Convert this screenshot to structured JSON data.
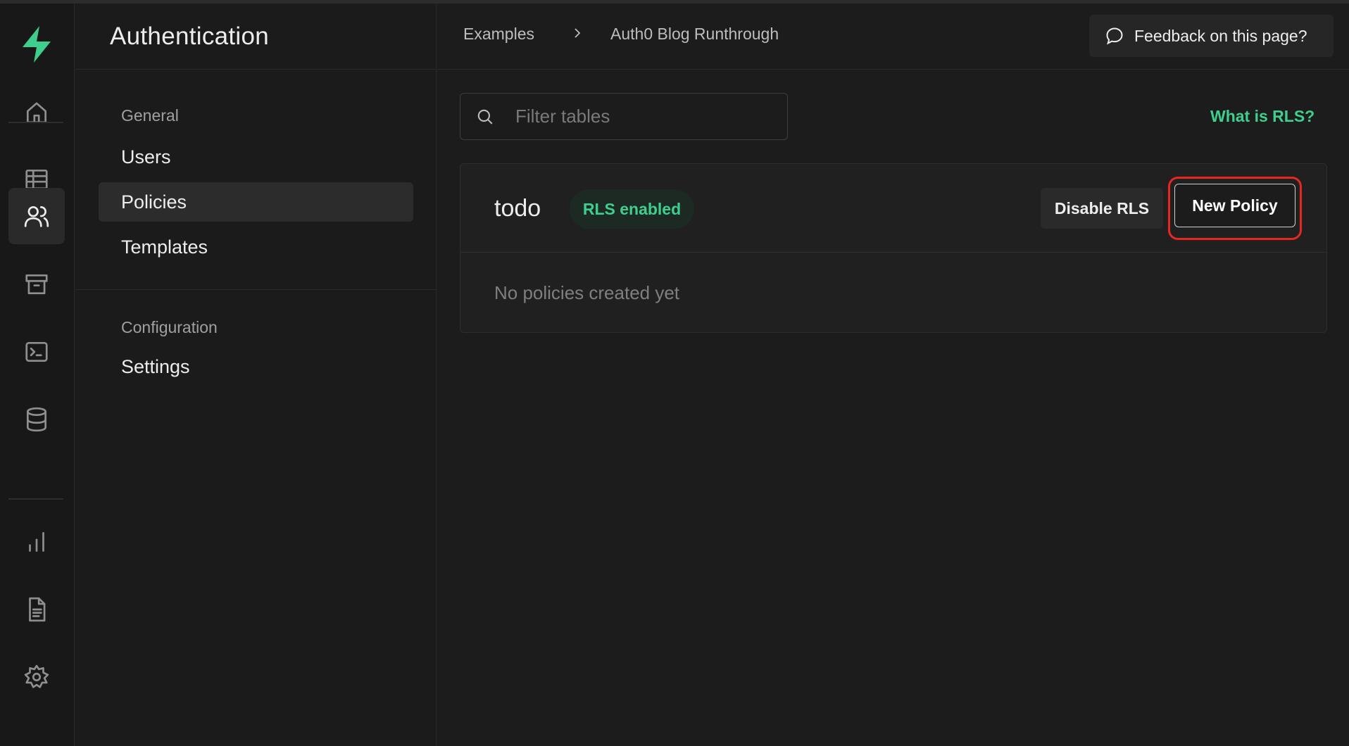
{
  "rail": {
    "items": [
      {
        "icon": "home-icon"
      },
      {
        "icon": "table-editor-icon"
      },
      {
        "icon": "users-icon"
      },
      {
        "icon": "storage-icon"
      },
      {
        "icon": "terminal-icon"
      },
      {
        "icon": "database-icon"
      },
      {
        "icon": "reports-icon"
      },
      {
        "icon": "logs-icon"
      },
      {
        "icon": "settings-icon"
      }
    ],
    "active": "users-icon",
    "brand_color": "#3ecf8e"
  },
  "subnav": {
    "title": "Authentication",
    "groups": [
      {
        "label": "General",
        "items": [
          "Users",
          "Policies",
          "Templates"
        ]
      },
      {
        "label": "Configuration",
        "items": [
          "Settings"
        ]
      }
    ],
    "active_item": "Policies"
  },
  "topbar": {
    "breadcrumb": [
      "Examples",
      "Auth0 Blog Runthrough"
    ],
    "feedback_label": "Feedback on this page?"
  },
  "main": {
    "filter_placeholder": "Filter tables",
    "rls_link": "What is RLS?",
    "table": {
      "name": "todo",
      "badge": "RLS enabled",
      "disable_label": "Disable RLS",
      "new_policy_label": "New Policy",
      "empty_text": "No policies created yet"
    }
  },
  "colors": {
    "accent": "#3ecf8e",
    "highlight": "#e5281f"
  }
}
